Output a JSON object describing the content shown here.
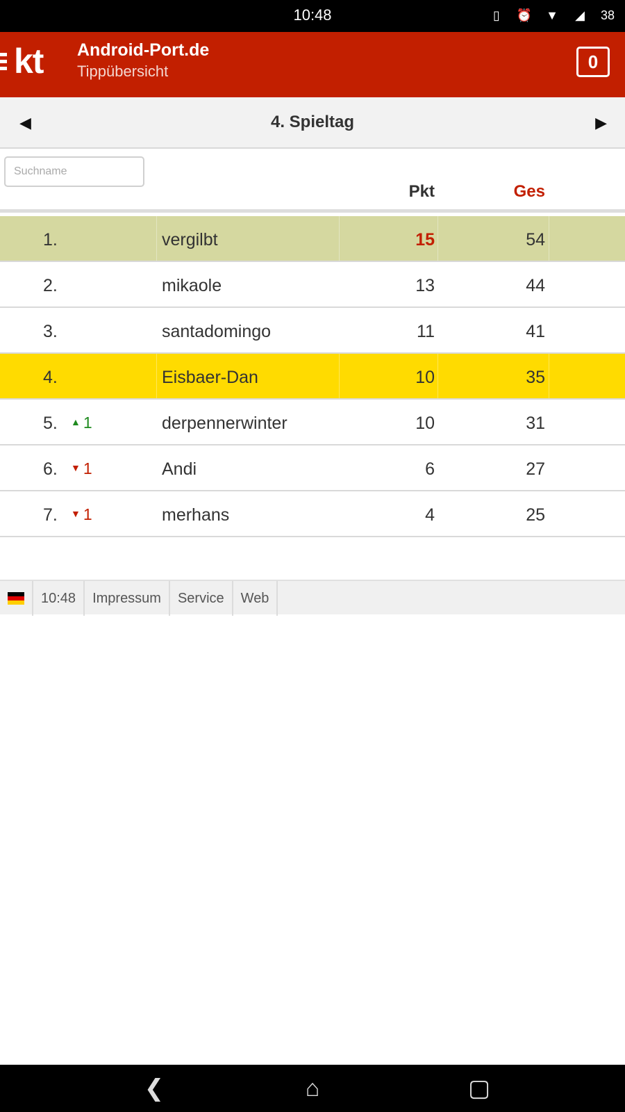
{
  "status_bar": {
    "time": "10:48",
    "battery": "38"
  },
  "header": {
    "logo_text": "kt",
    "title": "Android-Port.de",
    "subtitle": "Tippübersicht",
    "counter": "0",
    "background_color": "#c21f00"
  },
  "matchday": {
    "title": "4. Spieltag",
    "prev_icon": "triangle-left",
    "next_icon": "triangle-right"
  },
  "table": {
    "search_placeholder": "Suchname",
    "col_pkt": "Pkt",
    "col_ges": "Ges",
    "rows": [
      {
        "rank": "1.",
        "trend": "",
        "name": "vergilbt",
        "pkt": "15",
        "ges": "54",
        "highlight": "leader"
      },
      {
        "rank": "2.",
        "trend": "",
        "name": "mikaole",
        "pkt": "13",
        "ges": "44",
        "highlight": ""
      },
      {
        "rank": "3.",
        "trend": "",
        "name": "santadomingo",
        "pkt": "11",
        "ges": "41",
        "highlight": ""
      },
      {
        "rank": "4.",
        "trend": "",
        "name": "Eisbaer-Dan",
        "pkt": "10",
        "ges": "35",
        "highlight": "me"
      },
      {
        "rank": "5.",
        "trend": "1",
        "trend_dir": "up",
        "name": "derpennerwinter",
        "pkt": "10",
        "ges": "31",
        "highlight": ""
      },
      {
        "rank": "6.",
        "trend": "1",
        "trend_dir": "down",
        "name": "Andi",
        "pkt": "6",
        "ges": "27",
        "highlight": ""
      },
      {
        "rank": "7.",
        "trend": "1",
        "trend_dir": "down",
        "name": "merhans",
        "pkt": "4",
        "ges": "25",
        "highlight": ""
      }
    ]
  },
  "footer": {
    "time": "10:48",
    "impressum": "Impressum",
    "service": "Service",
    "web": "Web"
  },
  "colors": {
    "leader_row": "#d5d8a0",
    "my_row": "#ffdb00",
    "accent_red": "#c21f00",
    "trend_up": "#1f8a1f"
  }
}
